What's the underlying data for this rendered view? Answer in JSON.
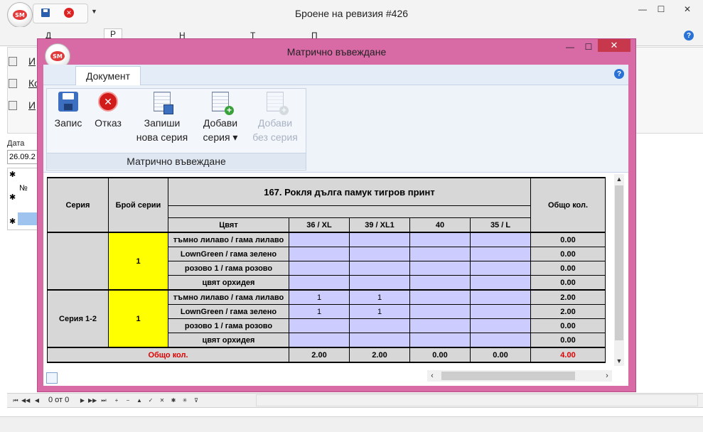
{
  "main_window": {
    "title": "Броене на ревизия #426",
    "logo_text": "SM",
    "tabs": [
      {
        "label": "Д"
      },
      {
        "label": "Р"
      },
      {
        "label": "Н"
      },
      {
        "label": "Т"
      },
      {
        "label": "П"
      }
    ],
    "ribbon_items": [
      "И",
      "Ко",
      "И"
    ],
    "date_label": "Дата",
    "date_value": "26.09.2",
    "grid_rows": [
      "✱",
      "✱",
      "№",
      "✱"
    ],
    "nav_status": "0 от 0",
    "window_buttons": {
      "minimize": "—",
      "maximize": "☐",
      "close": "✕"
    }
  },
  "dialog": {
    "title": "Матрично въвеждане",
    "logo_text": "SM",
    "tab_label": "Документ",
    "window_buttons": {
      "minimize": "—",
      "maximize": "☐",
      "close": "✕"
    },
    "ribbon": {
      "group_label": "Матрично въвеждане",
      "buttons": [
        {
          "line1": "Запис",
          "line2": "",
          "icon": "save-icon",
          "enabled": true
        },
        {
          "line1": "Отказ",
          "line2": "",
          "icon": "cancel-icon",
          "enabled": true
        },
        {
          "line1": "Запиши",
          "line2": "нова серия",
          "icon": "grid-save-icon",
          "enabled": true
        },
        {
          "line1": "Добави",
          "line2": "серия ▾",
          "icon": "grid-add-icon",
          "enabled": true
        },
        {
          "line1": "Добави",
          "line2": "без серия",
          "icon": "grid-add-icon",
          "enabled": false
        }
      ]
    },
    "matrix": {
      "headers": {
        "series": "Серия",
        "series_count": "Брой серии",
        "product": "167. Рокля дълга памук тигров принт",
        "total": "Общо кол.",
        "color": "Цвят",
        "sizes": [
          "36 / XL",
          "39 / XL1",
          "40",
          "35 / L"
        ]
      },
      "groups": [
        {
          "series": "",
          "count": "1",
          "rows": [
            {
              "color": "тъмно лилаво / гама лилаво",
              "values": [
                "",
                "",
                "",
                ""
              ],
              "total": "0.00"
            },
            {
              "color": "LownGreen / гама зелено",
              "values": [
                "",
                "",
                "",
                ""
              ],
              "total": "0.00"
            },
            {
              "color": "розово 1 / гама розово",
              "values": [
                "",
                "",
                "",
                ""
              ],
              "total": "0.00"
            },
            {
              "color": "цвят орхидея",
              "values": [
                "",
                "",
                "",
                ""
              ],
              "total": "0.00"
            }
          ]
        },
        {
          "series": "Серия 1-2",
          "count": "1",
          "rows": [
            {
              "color": "тъмно лилаво / гама лилаво",
              "values": [
                "1",
                "1",
                "",
                ""
              ],
              "total": "2.00"
            },
            {
              "color": "LownGreen / гама зелено",
              "values": [
                "1",
                "1",
                "",
                ""
              ],
              "total": "2.00"
            },
            {
              "color": "розово 1 / гама розово",
              "values": [
                "",
                "",
                "",
                ""
              ],
              "total": "0.00"
            },
            {
              "color": "цвят орхидея",
              "values": [
                "",
                "",
                "",
                ""
              ],
              "total": "0.00"
            }
          ]
        }
      ],
      "footer": {
        "label": "Общо кол.",
        "size_totals": [
          "2.00",
          "2.00",
          "0.00",
          "0.00"
        ],
        "grand_total": "4.00"
      }
    }
  },
  "colors": {
    "dialog_frame": "#d86aa6",
    "close_button": "#c7384d",
    "lavender_cell": "#ccccfe",
    "yellow_cell": "#ffff00",
    "gray_cell": "#d7d7d7",
    "total_red": "#e00000"
  }
}
